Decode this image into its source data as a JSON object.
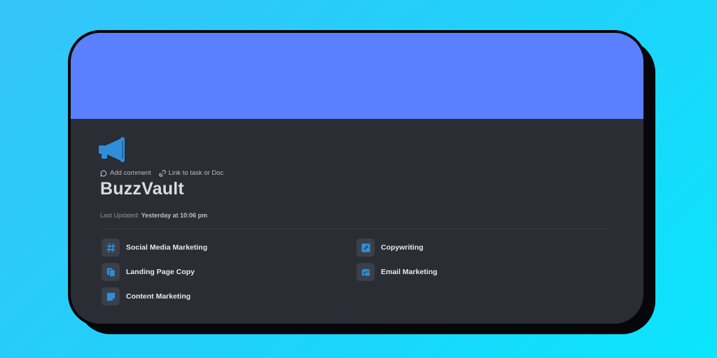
{
  "page": {
    "title": "BuzzVault",
    "icon": "megaphone-icon",
    "cover_color": "#5b80ff",
    "accent_color": "#2e8fd8"
  },
  "actions": {
    "add_comment": "Add comment",
    "link_task": "Link to task or Doc"
  },
  "meta": {
    "updated_label": "Last Updated:",
    "updated_value": "Yesterday at 10:06 pm"
  },
  "subpages": [
    {
      "label": "Social Media Marketing",
      "icon": "hashtag-icon"
    },
    {
      "label": "Copywriting",
      "icon": "pencil-square-icon"
    },
    {
      "label": "Landing Page Copy",
      "icon": "copy-pages-icon"
    },
    {
      "label": "Email Marketing",
      "icon": "mailbox-icon"
    },
    {
      "label": "Content Marketing",
      "icon": "sticky-note-icon"
    }
  ]
}
